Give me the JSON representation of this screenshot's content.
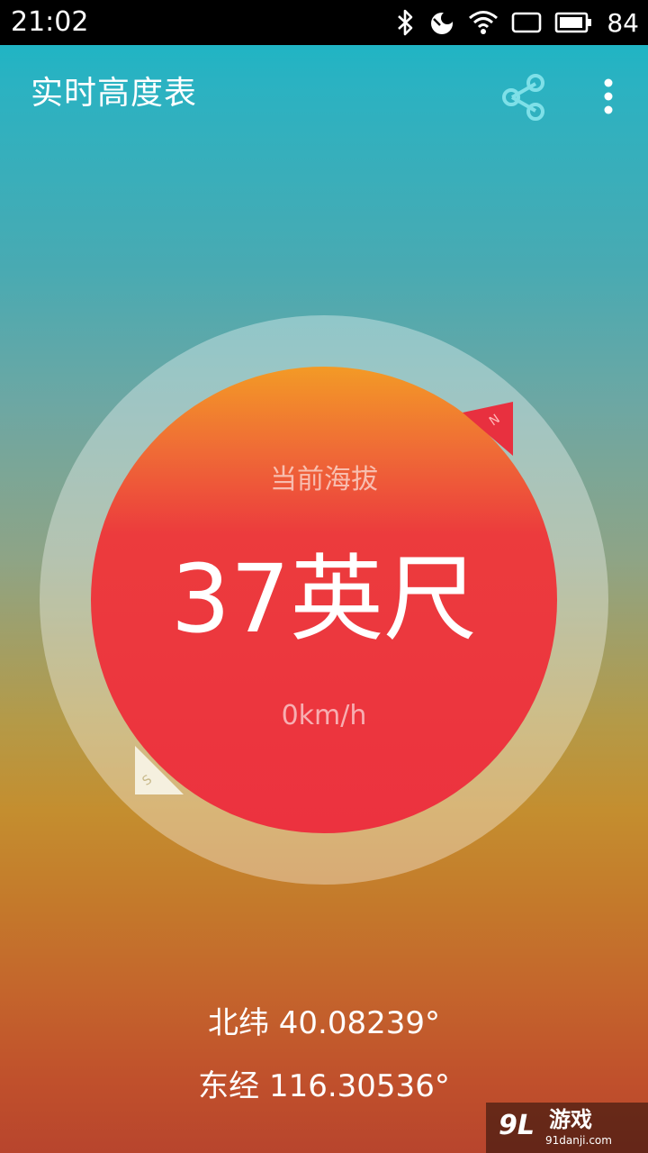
{
  "status_bar": {
    "time": "21:02",
    "battery_level": "84",
    "icons": [
      "bluetooth-icon",
      "do-not-disturb-icon",
      "wifi-icon",
      "signal-icon",
      "battery-icon"
    ]
  },
  "toolbar": {
    "title": "实时高度表",
    "share_icon": "share-icon",
    "more_icon": "more-vert-icon"
  },
  "gauge": {
    "label": "当前海拔",
    "altitude": "37英尺",
    "speed": "0km/h",
    "north_marker": "N",
    "south_marker": "S"
  },
  "location": {
    "latitude": "北纬 40.08239°",
    "longitude": "东经 116.30536°"
  },
  "watermark": {
    "logo": "9L",
    "brand": "游戏",
    "url": "91danji.com"
  },
  "colors": {
    "status_bar": "#000000",
    "gradient_top": "#14b7c6",
    "gradient_bottom": "#b8452d",
    "circle_top": "#f39a26",
    "circle_main": "#ec323f",
    "north_marker": "#e8303f",
    "south_marker": "#f5f0df"
  }
}
